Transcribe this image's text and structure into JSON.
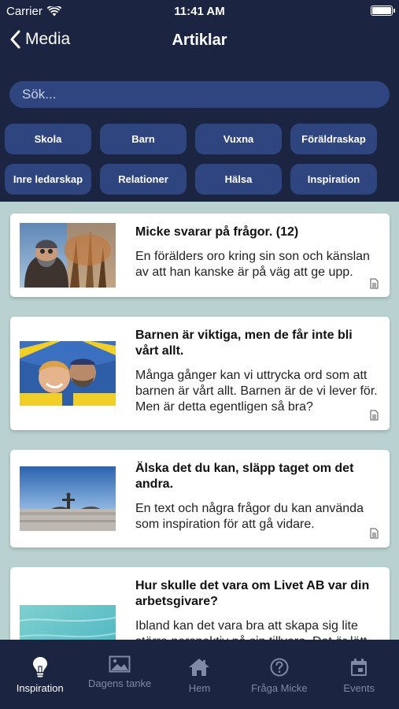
{
  "status_bar": {
    "carrier": "Carrier",
    "time": "11:41 AM"
  },
  "nav": {
    "back_label": "Media",
    "title": "Artiklar"
  },
  "search": {
    "placeholder": "Sök..."
  },
  "categories": [
    "Skola",
    "Barn",
    "Vuxna",
    "Föräldraskap",
    "Inre ledarskap",
    "Relationer",
    "Hälsa",
    "Inspiration"
  ],
  "articles": [
    {
      "title": "Micke svarar på frågor. (12)",
      "description": "En förälders oro kring sin son och känslan av att han kanske är på väg att ge upp.",
      "icon": "document-icon"
    },
    {
      "title": "Barnen är viktiga, men de får inte bli vårt allt.",
      "description": "Många gånger kan vi uttrycka ord som att barnen är vårt allt. Barnen är de vi lever för. Men är detta egentligen så bra?",
      "icon": "document-icon"
    },
    {
      "title": "Älska det du kan, släpp taget om det andra.",
      "description": "En text och några frågor du kan använda som inspiration för att gå vidare.",
      "icon": "document-icon"
    },
    {
      "title": "Hur skulle det vara om Livet AB var din arbetsgivare?",
      "description": "Ibland kan det vara bra att skapa sig lite större perspektiv på sin tillvaro. Det är lätt",
      "icon": "document-icon"
    }
  ],
  "tabs": [
    {
      "label": "Inspiration",
      "icon": "lightbulb-icon",
      "active": true
    },
    {
      "label": "Dagens tanke",
      "icon": "image-icon",
      "active": false
    },
    {
      "label": "Hem",
      "icon": "home-icon",
      "active": false
    },
    {
      "label": "Fråga Micke",
      "icon": "question-icon",
      "active": false
    },
    {
      "label": "Events",
      "icon": "calendar-icon",
      "active": false
    }
  ],
  "colors": {
    "background": "#1b2441",
    "chip": "#2f4580",
    "content_bg": "#b9d1d0",
    "tab_inactive": "#7f8aa6"
  }
}
